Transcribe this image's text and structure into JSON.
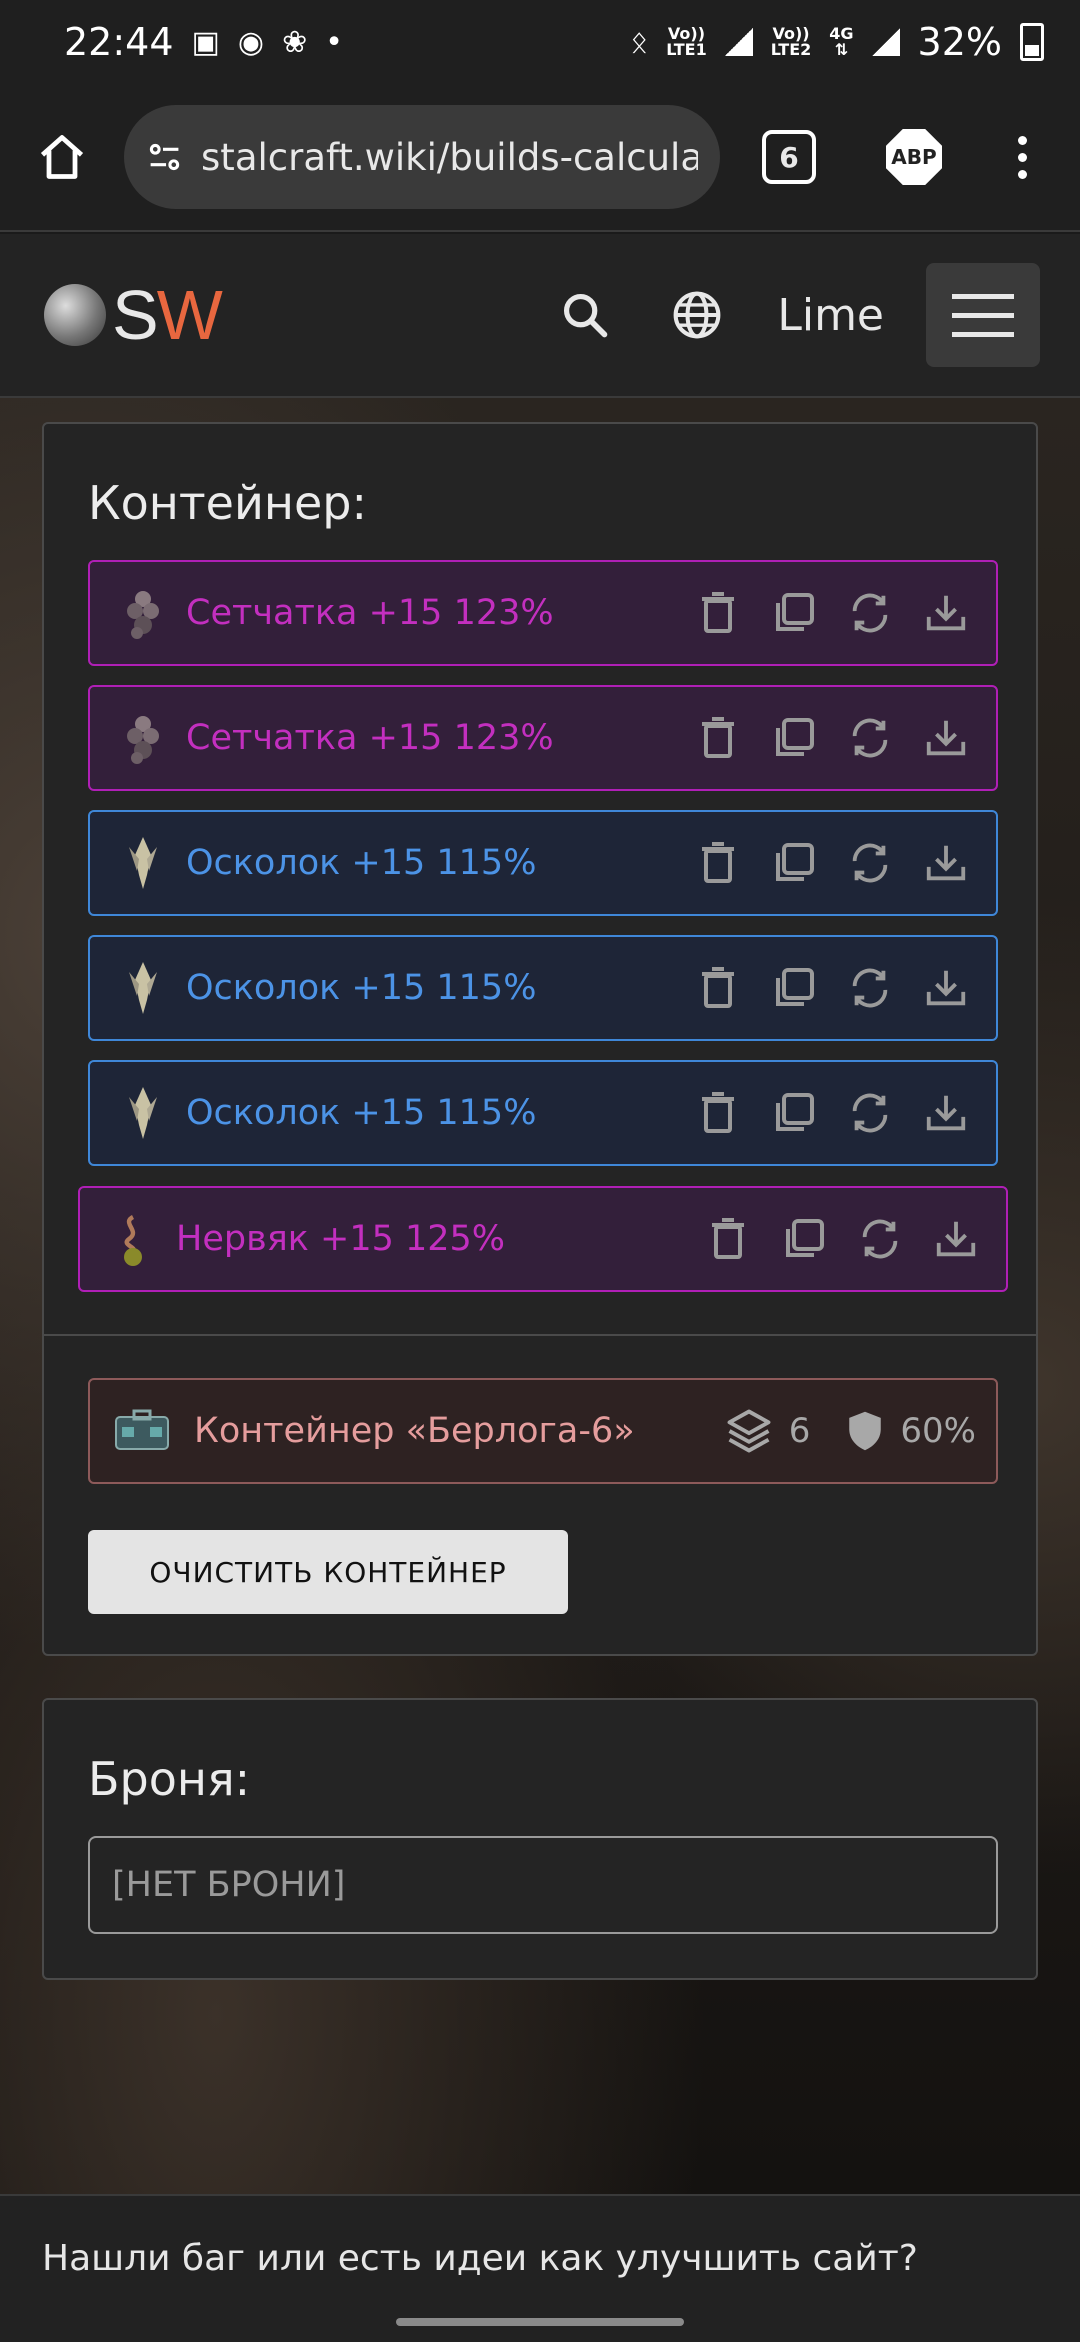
{
  "status_bar": {
    "time": "22:44",
    "sim1_top": "Vo))",
    "sim1_bottom": "LTE1",
    "sim2_top": "Vo))",
    "sim2_bottom": "LTE2",
    "network": "4G",
    "battery": "32%"
  },
  "browser": {
    "url": "stalcraft.wiki/builds-calculatc",
    "tab_count": "6",
    "adblock_label": "ABP"
  },
  "site_header": {
    "logo_s": "S",
    "logo_w": "W",
    "language": "Lime"
  },
  "container_section": {
    "title": "Контейнер:",
    "items": [
      {
        "name": "Сетчатка +15 123%",
        "rarity": "purple",
        "icon": "artifact-setchatka-icon"
      },
      {
        "name": "Сетчатка +15 123%",
        "rarity": "purple",
        "icon": "artifact-setchatka-icon"
      },
      {
        "name": "Осколок +15 115%",
        "rarity": "blue",
        "icon": "artifact-oskolok-icon"
      },
      {
        "name": "Осколок +15 115%",
        "rarity": "blue",
        "icon": "artifact-oskolok-icon"
      },
      {
        "name": "Осколок +15 115%",
        "rarity": "blue",
        "icon": "artifact-oskolok-icon"
      },
      {
        "name": "Нервяк +15 125%",
        "rarity": "purple",
        "icon": "artifact-nervyak-icon"
      }
    ],
    "container": {
      "name": "Контейнер «Берлога-6»",
      "slots": "6",
      "protection": "60%"
    },
    "clear_button": "ОЧИСТИТЬ КОНТЕЙНЕР"
  },
  "armor_section": {
    "title": "Броня:",
    "selected": "[НЕТ БРОНИ]"
  },
  "footer": {
    "text": "Нашли баг или есть идеи как улучшить сайт?"
  },
  "colors": {
    "rarity_purple": "#b01fb6",
    "rarity_blue": "#3f87d8",
    "logo_accent": "#e8673f"
  }
}
